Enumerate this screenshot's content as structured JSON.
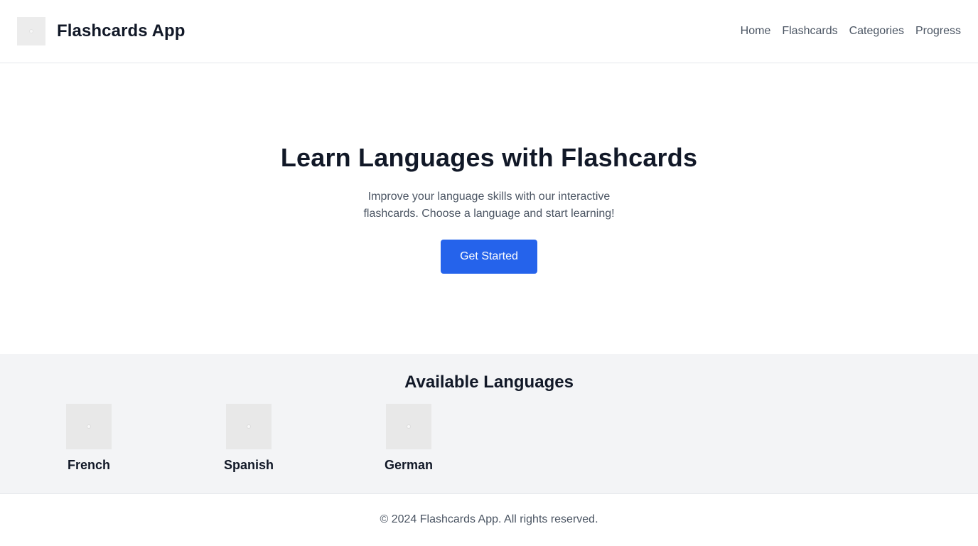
{
  "header": {
    "logo_icon": "app-logo-icon",
    "title": "Flashcards App",
    "nav": [
      {
        "label": "Home"
      },
      {
        "label": "Flashcards"
      },
      {
        "label": "Categories"
      },
      {
        "label": "Progress"
      }
    ]
  },
  "hero": {
    "title": "Learn Languages with Flashcards",
    "description": "Improve your language skills with our interactive flashcards. Choose a language and start learning!",
    "cta_label": "Get Started"
  },
  "languages": {
    "heading": "Available Languages",
    "items": [
      {
        "name": "French",
        "icon": "french-flag-icon"
      },
      {
        "name": "Spanish",
        "icon": "spanish-flag-icon"
      },
      {
        "name": "German",
        "icon": "german-flag-icon"
      }
    ]
  },
  "footer": {
    "copyright": "© 2024 Flashcards App. All rights reserved."
  },
  "colors": {
    "accent": "#2563eb",
    "text_primary": "#111827",
    "text_secondary": "#4b5563",
    "section_bg": "#f3f4f6",
    "border": "#e5e7eb"
  }
}
